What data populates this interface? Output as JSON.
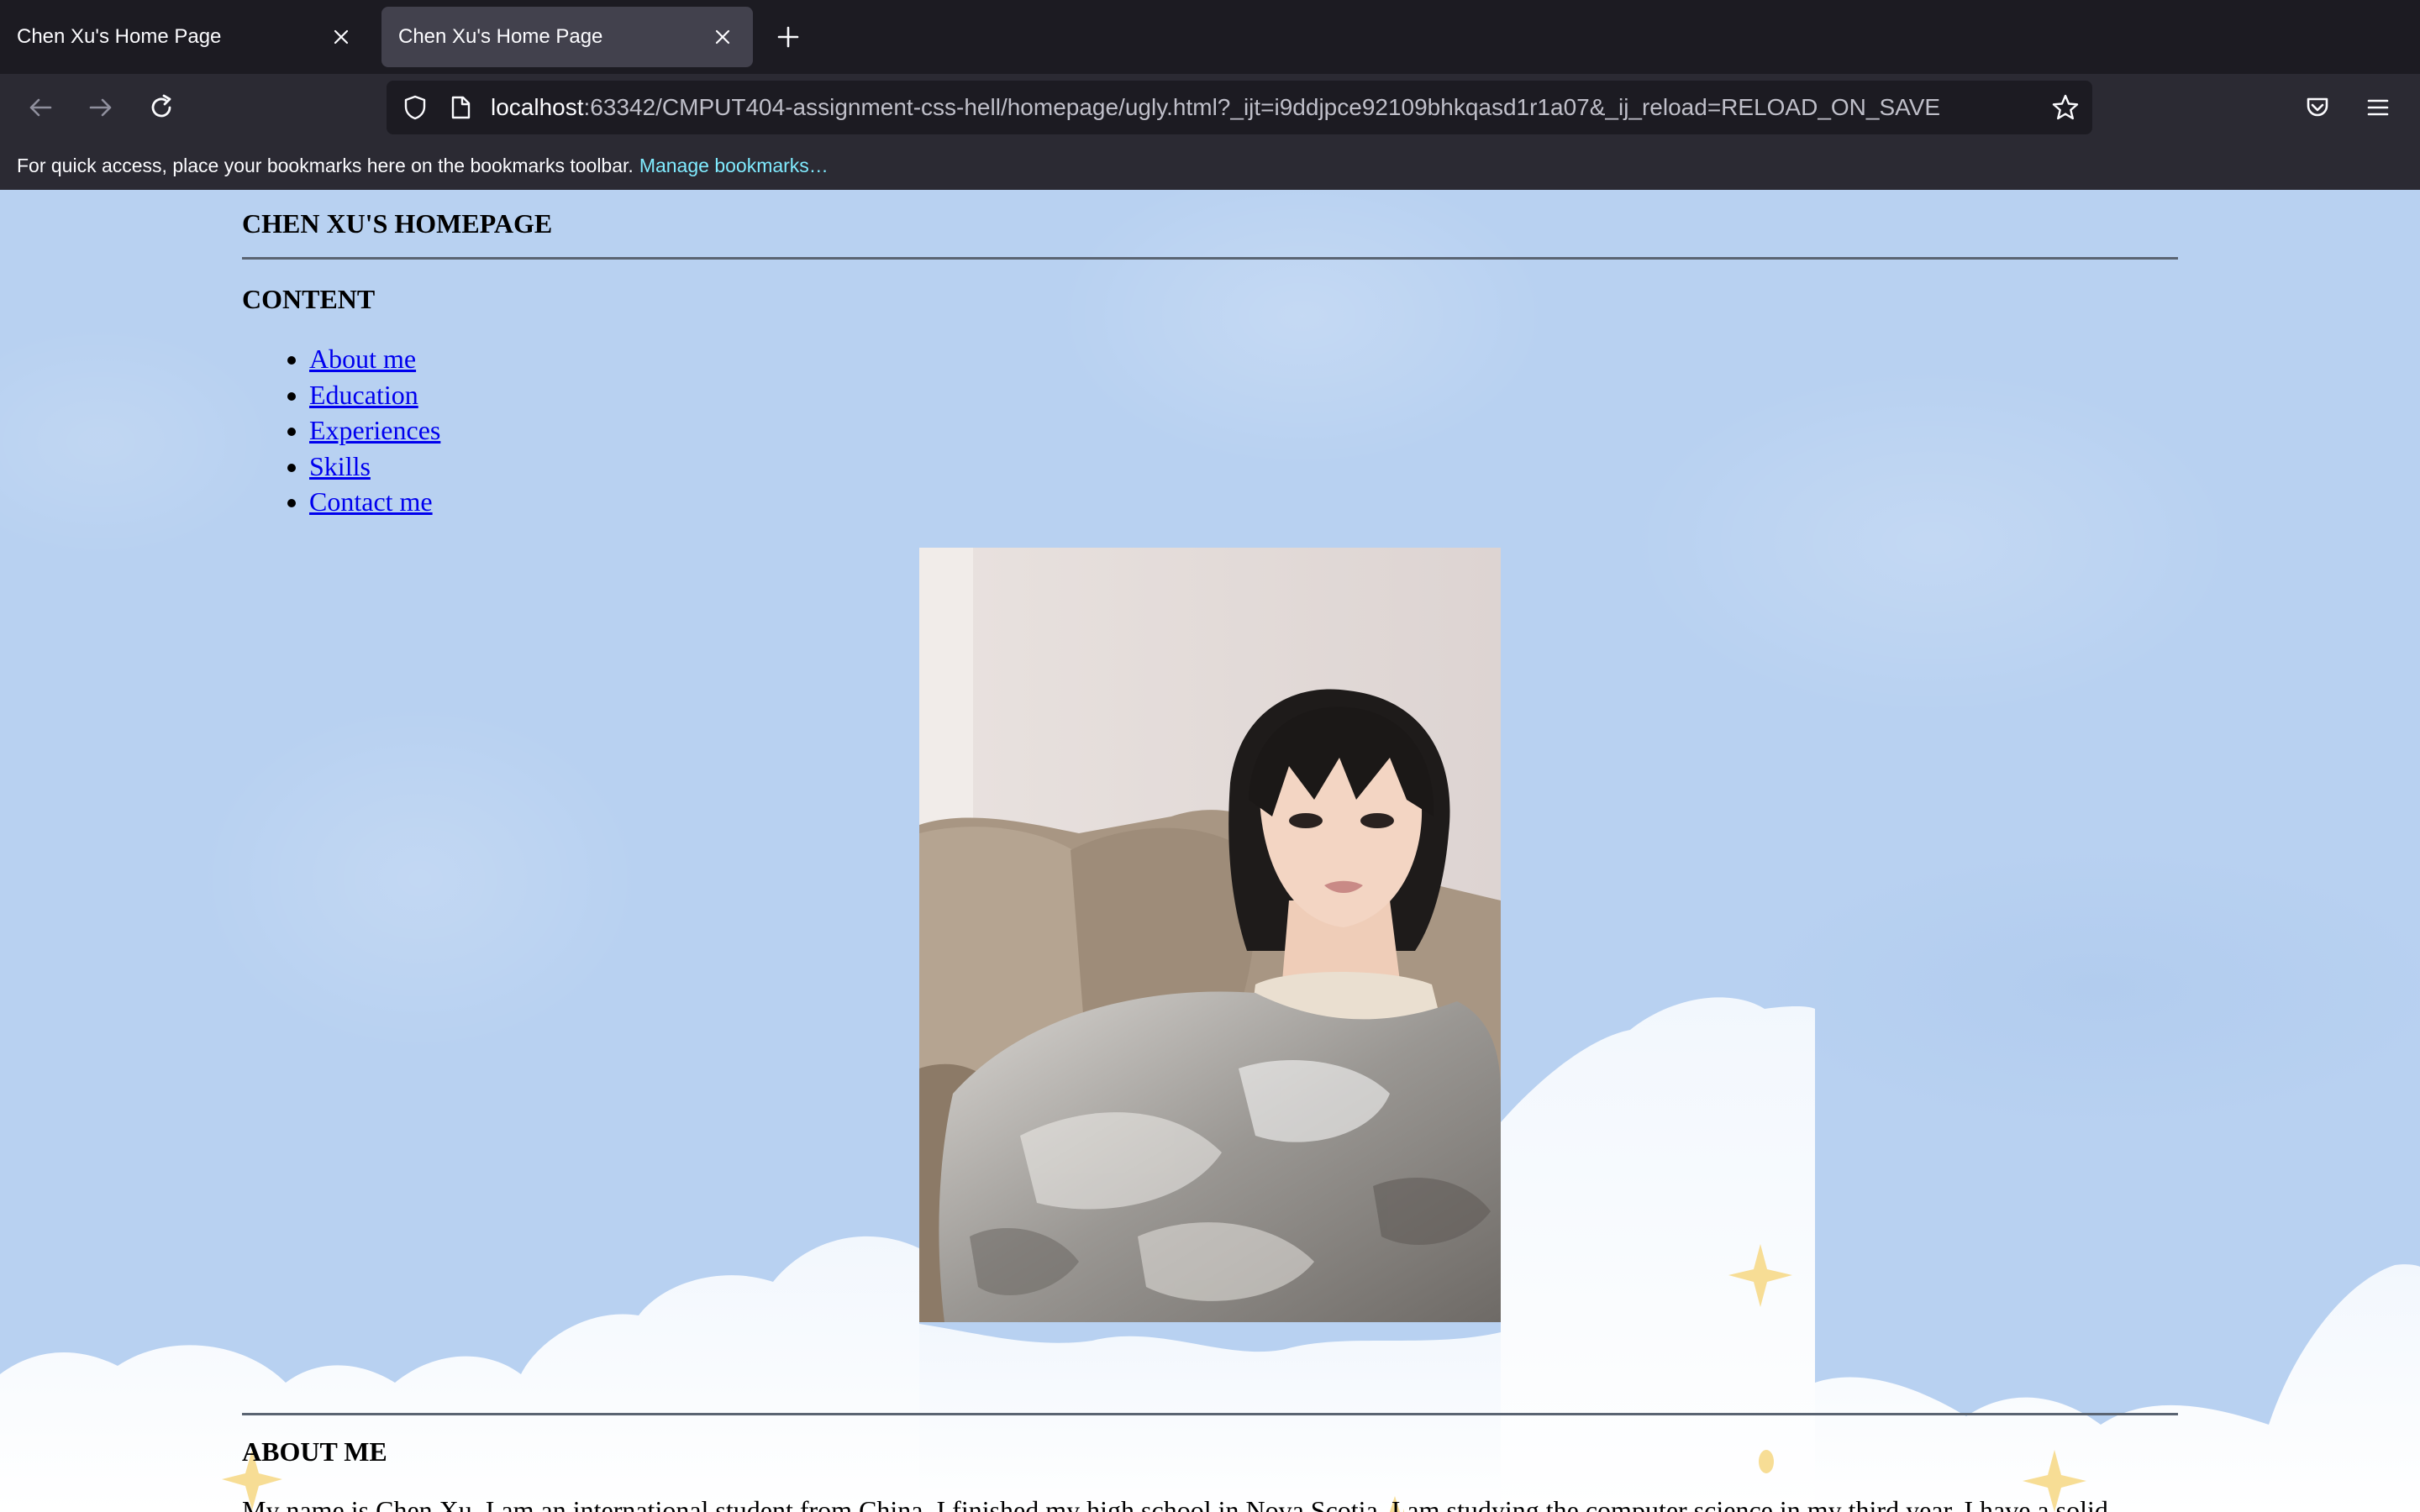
{
  "browser": {
    "tabs": [
      {
        "title": "Chen Xu's Home Page",
        "active": false
      },
      {
        "title": "Chen Xu's Home Page",
        "active": true
      }
    ],
    "url": {
      "host": "localhost",
      "path": ":63342/CMPUT404-assignment-css-hell/homepage/ugly.html?_ijt=i9ddjpce92109bhkqasd1r1a07&_ij_reload=RELOAD_ON_SAVE"
    },
    "bookmarks_bar": {
      "message": "For quick access, place your bookmarks here on the bookmarks toolbar.",
      "link": "Manage bookmarks…"
    },
    "icons": [
      "back-icon",
      "forward-icon",
      "reload-icon",
      "shield-icon",
      "page-icon",
      "star-icon",
      "pocket-icon",
      "menu-icon",
      "close-icon",
      "plus-icon"
    ]
  },
  "page": {
    "title": "CHEN XU'S HOMEPAGE",
    "content_heading": "CONTENT",
    "toc": [
      "About me",
      "Education",
      "Experiences",
      "Skills",
      "Contact me"
    ],
    "about_heading": "ABOUT ME",
    "about_text": "My name is Chen Xu. I am an international student from China. I finished my high school in Nova Scotia. I am studying the computer science in my third year. I have a solid"
  },
  "colors": {
    "page_background": "#b8d1f1",
    "link": "#0000ee",
    "tab_active": "#42414d",
    "toolbar": "#2b2a33",
    "bookmark_link": "#80ebff"
  }
}
